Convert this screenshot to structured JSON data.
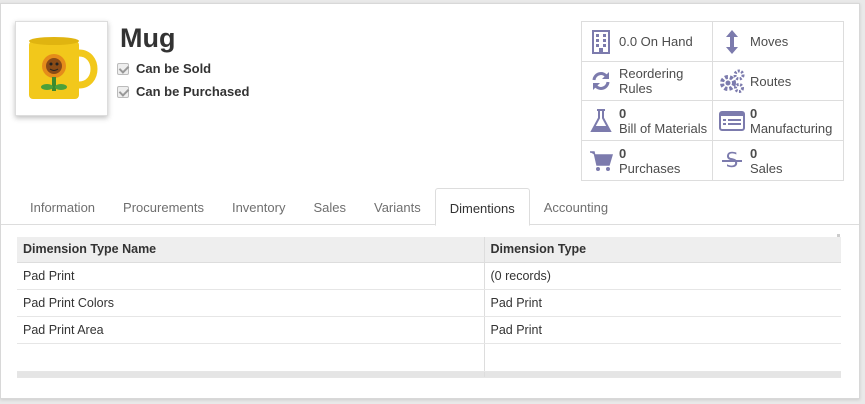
{
  "product": {
    "name": "Mug",
    "can_be_sold_label": "Can be Sold",
    "can_be_purchased_label": "Can be Purchased"
  },
  "stats": [
    {
      "icon": "building-icon",
      "number": "",
      "label": "0.0 On Hand"
    },
    {
      "icon": "updown-arrows-icon",
      "number": "",
      "label": "Moves"
    },
    {
      "icon": "refresh-icon",
      "number": "",
      "label": "Reordering Rules"
    },
    {
      "icon": "cogs-icon",
      "number": "",
      "label": "Routes"
    },
    {
      "icon": "flask-icon",
      "number": "0",
      "label": "Bill of Materials"
    },
    {
      "icon": "list-icon",
      "number": "0",
      "label": "Manufacturing"
    },
    {
      "icon": "cart-icon",
      "number": "0",
      "label": "Purchases"
    },
    {
      "icon": "dollar-icon",
      "number": "0",
      "label": "Sales"
    }
  ],
  "tabs": [
    "Information",
    "Procurements",
    "Inventory",
    "Sales",
    "Variants",
    "Dimentions",
    "Accounting"
  ],
  "active_tab": "Dimentions",
  "table": {
    "headers": [
      "Dimension Type Name",
      "Dimension Type"
    ],
    "rows": [
      [
        "Pad Print",
        "(0 records)"
      ],
      [
        "Pad Print Colors",
        "Pad Print"
      ],
      [
        "Pad Print Area",
        "Pad Print"
      ]
    ]
  },
  "colors": {
    "icon": "#7c7bad",
    "mug": "#f2c81b"
  }
}
